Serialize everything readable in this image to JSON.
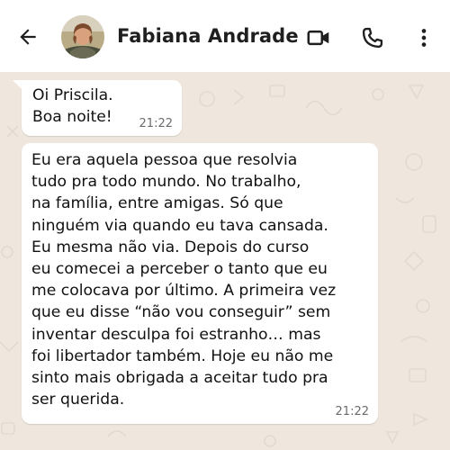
{
  "header": {
    "contact_name": "Fabiana Andrade",
    "icons": [
      "back-arrow-icon",
      "video-call-icon",
      "phone-icon",
      "more-vert-icon"
    ]
  },
  "messages": [
    {
      "text": "Oi Priscila.\nBoa noite!",
      "time": "21:22",
      "direction": "incoming"
    },
    {
      "text": "Eu era aquela pessoa que resolvia\ntudo pra todo mundo. No trabalho,\nna família, entre amigas. Só que\nninguém via quando eu tava cansada.\nEu mesma não via. Depois do curso\neu comecei a perceber o tanto que eu\nme colocava por último. A primeira vez\nque eu disse “não vou conseguir” sem\ninventar desculpa foi estranho… mas\nfoi libertador também. Hoje eu não me\nsinto mais obrigada a aceitar tudo pra\nser querida.",
      "time": "21:22",
      "direction": "incoming"
    }
  ],
  "colors": {
    "header_bg": "#ffffff",
    "chat_bg": "#efe7de",
    "bubble_bg": "#ffffff",
    "icon": "#1f1f1f",
    "timestamp": "#6b6b6b"
  }
}
